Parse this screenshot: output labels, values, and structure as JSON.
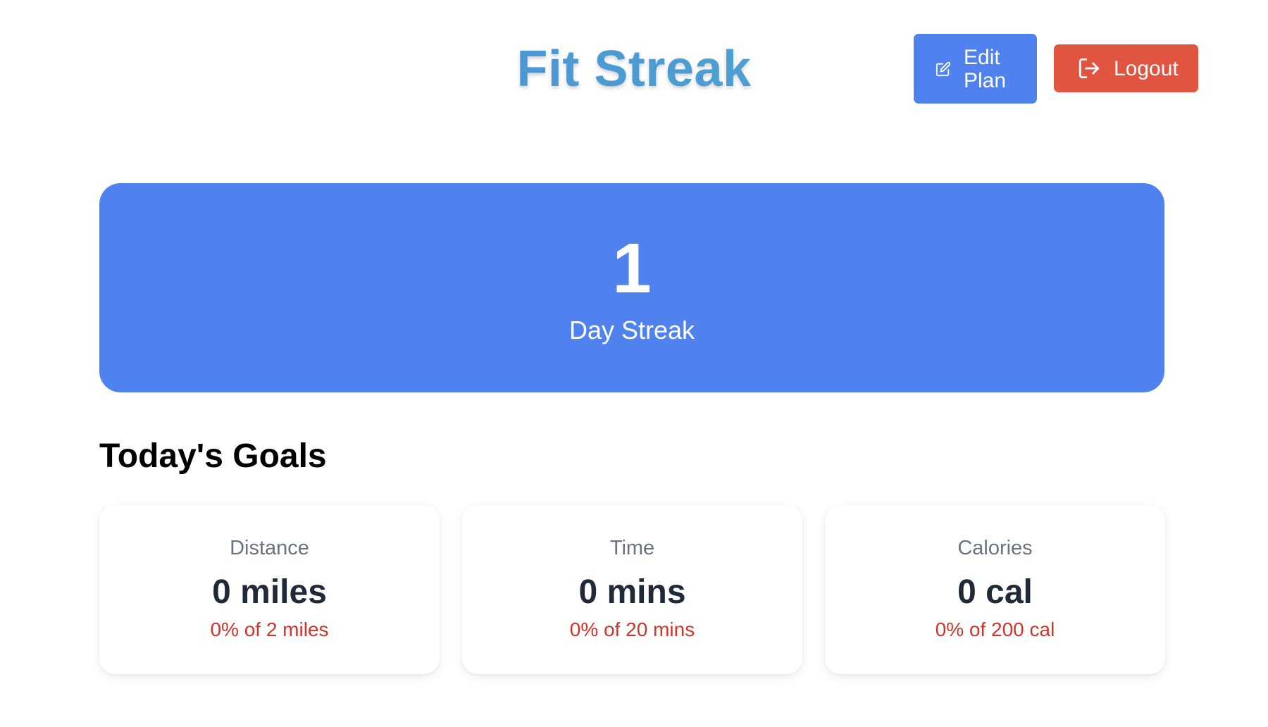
{
  "header": {
    "title": "Fit Streak",
    "edit_plan_label": "Edit Plan",
    "logout_label": "Logout",
    "edit_icon": "edit-icon",
    "logout_icon": "logout-icon"
  },
  "streak": {
    "count": "1",
    "label": "Day Streak"
  },
  "goals": {
    "heading": "Today's Goals",
    "items": [
      {
        "name": "Distance",
        "value": "0 miles",
        "progress": "0% of 2 miles"
      },
      {
        "name": "Time",
        "value": "0 mins",
        "progress": "0% of 20 mins"
      },
      {
        "name": "Calories",
        "value": "0 cal",
        "progress": "0% of 200 cal"
      }
    ]
  },
  "colors": {
    "primary": "#4f82ee",
    "danger": "#e05440",
    "progress_text": "#d0352b",
    "title_gradient_start": "#4a86e0",
    "title_gradient_end": "#4fb0c6"
  }
}
